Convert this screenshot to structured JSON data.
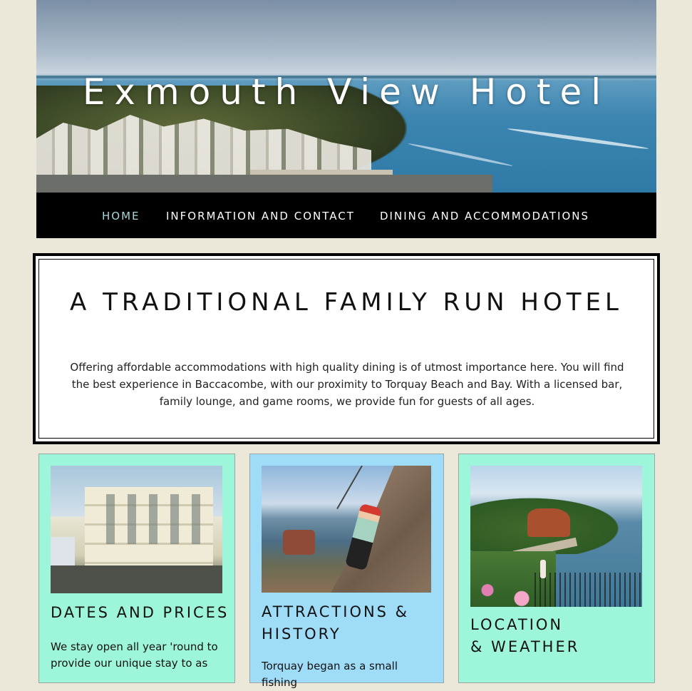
{
  "hero": {
    "title": "Exmouth View Hotel"
  },
  "nav": {
    "items": [
      {
        "label": "HOME",
        "active": true
      },
      {
        "label": "INFORMATION AND CONTACT",
        "active": false
      },
      {
        "label": "DINING AND ACCOMMODATIONS",
        "active": false
      }
    ]
  },
  "intro": {
    "title": "A TRADITIONAL FAMILY RUN HOTEL",
    "text": "Offering affordable accommodations with high quality dining is of utmost importance here. You will find the best experience in Baccacombe, with our proximity to Torquay Beach and Bay.  With a licensed bar, family lounge, and game rooms, we provide fun for guests of all ages."
  },
  "cards": [
    {
      "title": "DATES AND PRICES",
      "text": "We stay open all year 'round to provide our unique stay to as",
      "image": "hotel-building-photo"
    },
    {
      "title_line1": "ATTRACTIONS &",
      "title_line2": "HISTORY",
      "text": "Torquay began as a small fishing",
      "image": "rock-climber-photo"
    },
    {
      "title_line1": "LOCATION",
      "title_line2": "& WEATHER",
      "image": "coastline-photo"
    }
  ],
  "colors": {
    "page_background": "#ebe8d9",
    "nav_background": "#000000",
    "nav_active": "#a7d7d9",
    "card_green": "#9ef6da",
    "card_blue": "#9fdcf8"
  }
}
